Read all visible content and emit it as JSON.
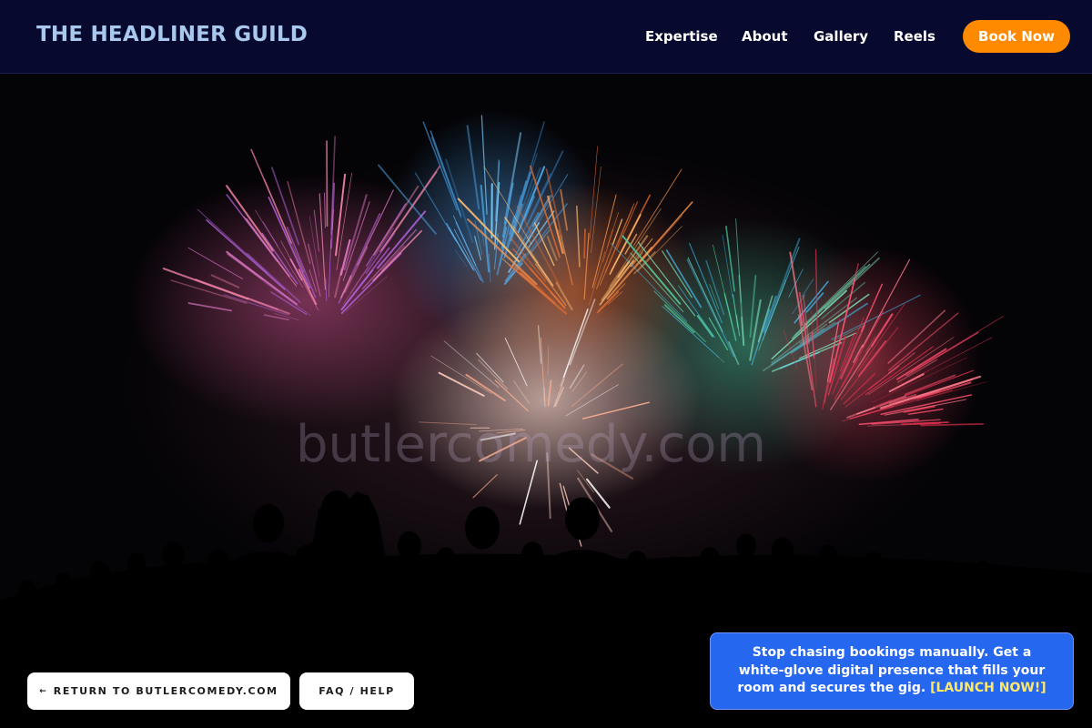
{
  "header": {
    "brand": "THE HEADLINER GUILD",
    "nav": {
      "expertise": "Expertise",
      "about": "About",
      "gallery": "Gallery",
      "reels": "Reels"
    },
    "cta": "Book Now"
  },
  "hero": {
    "watermark": "butlercomedy.com"
  },
  "footer": {
    "return_arrow": "←",
    "return_label": "RETURN TO BUTLERCOMEDY.COM",
    "faq_label": "FAQ / HELP"
  },
  "promo": {
    "text": "Stop chasing bookings manually. Get a white-glove digital presence that fills your room and secures the gig.",
    "link": "[LAUNCH NOW!]"
  },
  "colors": {
    "header_bg": "#070a2e",
    "brand_text": "#a9c8ee",
    "cta_orange": "#ff8a00",
    "promo_blue": "#2667f0",
    "promo_link": "#ffe96b"
  }
}
